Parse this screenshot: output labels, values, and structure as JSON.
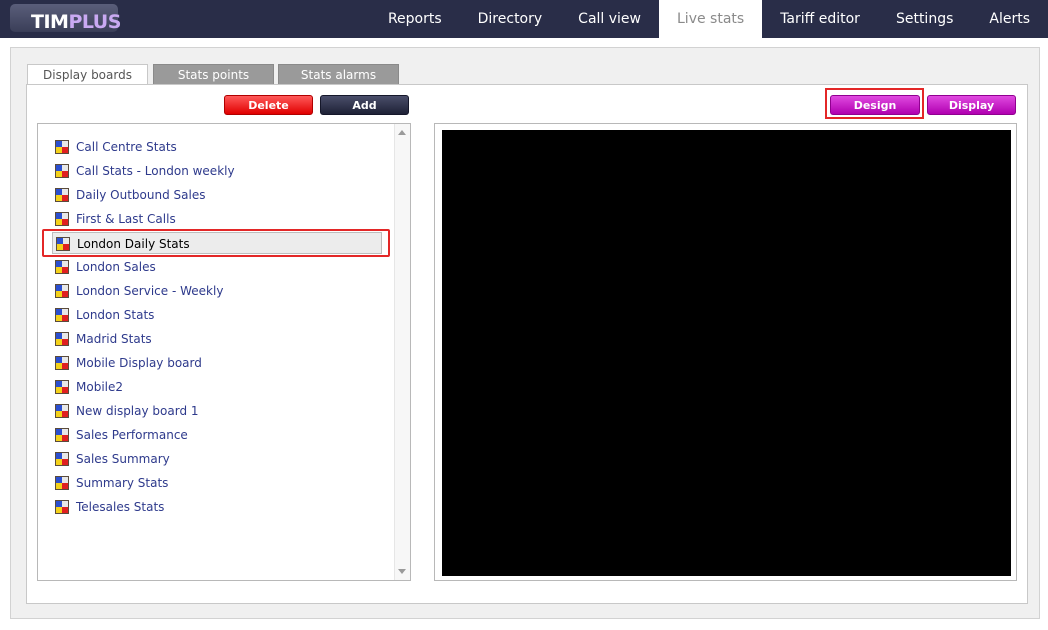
{
  "app": {
    "logo_main": "TIM",
    "logo_accent": "PLUS"
  },
  "nav": {
    "items": [
      {
        "label": "Reports"
      },
      {
        "label": "Directory"
      },
      {
        "label": "Call view"
      },
      {
        "label": "Live stats",
        "active": true
      },
      {
        "label": "Tariff editor"
      },
      {
        "label": "Settings"
      },
      {
        "label": "Alerts"
      }
    ]
  },
  "tabs": [
    {
      "label": "Display boards",
      "active": true
    },
    {
      "label": "Stats points"
    },
    {
      "label": "Stats alarms"
    }
  ],
  "buttons": {
    "delete": "Delete",
    "add": "Add",
    "design": "Design",
    "display": "Display"
  },
  "boards": {
    "items": [
      "Call Centre Stats",
      "Call Stats - London weekly",
      "Daily Outbound Sales",
      "First & Last Calls",
      "London Daily Stats",
      "London Sales",
      "London Service - Weekly",
      "London Stats",
      "Madrid Stats",
      "Mobile Display board",
      "Mobile2",
      "New display board 1",
      "Sales Performance",
      "Sales Summary",
      "Summary Stats",
      "Telesales Stats"
    ],
    "selected": "London Daily Stats"
  },
  "colors": {
    "topbar": "#292d48",
    "link": "#2e3a8c",
    "highlight": "#e32727",
    "delete": "#e00000",
    "design": "#b000b0"
  },
  "icons": {
    "board": "display-board-icon",
    "scroll_up": "scroll-up-arrow-icon",
    "scroll_down": "scroll-down-arrow-icon"
  }
}
